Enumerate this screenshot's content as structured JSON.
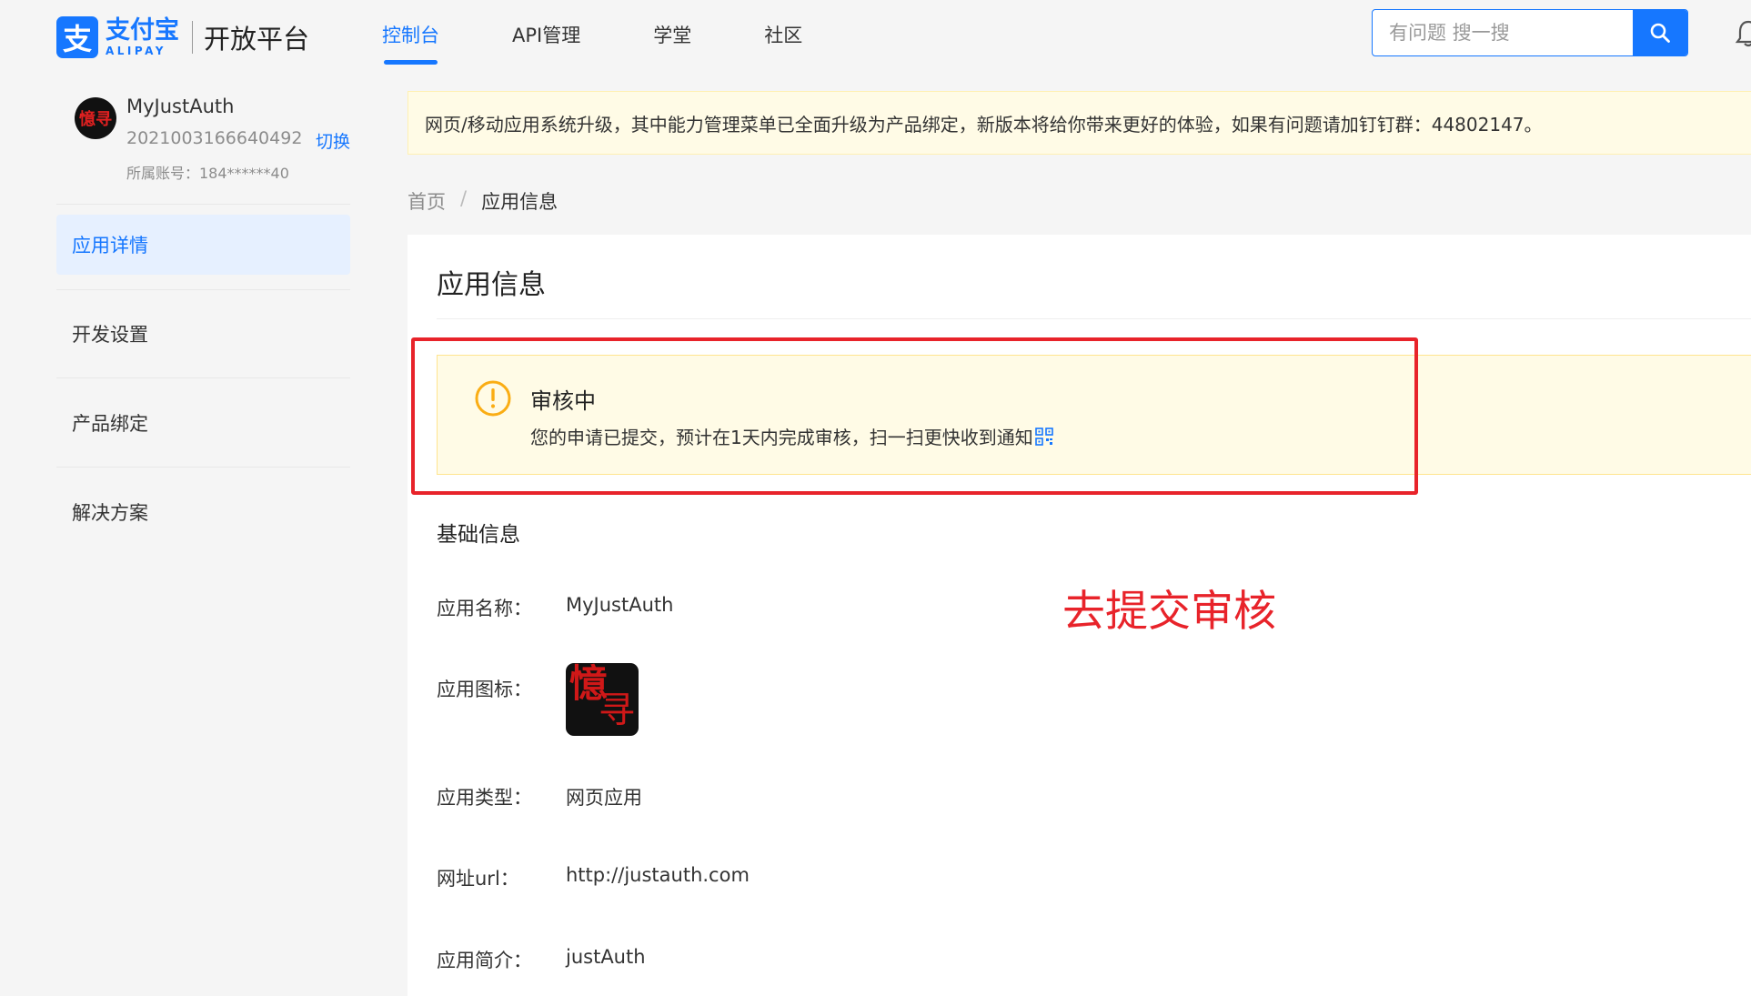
{
  "header": {
    "logo_mark": "支",
    "logo_cn": "支付宝",
    "logo_en": "ALIPAY",
    "platform": "开放平台",
    "nav": [
      {
        "label": "控制台",
        "active": true
      },
      {
        "label": "API管理",
        "active": false
      },
      {
        "label": "学堂",
        "active": false
      },
      {
        "label": "社区",
        "active": false
      }
    ],
    "search_placeholder": "有问题 搜一搜"
  },
  "sidebar": {
    "avatar_text": "憶寻",
    "account_name": "MyJustAuth",
    "account_id": "2021003166640492",
    "switch_label": "切换",
    "owner_text": "所属账号：184******40",
    "items": [
      {
        "label": "应用详情",
        "active": true
      },
      {
        "label": "开发设置",
        "active": false
      },
      {
        "label": "产品绑定",
        "active": false
      },
      {
        "label": "解决方案",
        "active": false
      }
    ]
  },
  "notice": "网页/移动应用系统升级，其中能力管理菜单已全面升级为产品绑定，新版本将给你带来更好的体验，如果有问题请加钉钉群：44802147。",
  "breadcrumb": {
    "home": "首页",
    "separator": "/",
    "current": "应用信息"
  },
  "card": {
    "title": "应用信息",
    "alert": {
      "title": "审核中",
      "desc": "您的申请已提交，预计在1天内完成审核，扫一扫更快收到通知",
      "color": "#faad14"
    },
    "annotation": "去提交审核",
    "section_title": "基础信息",
    "fields": {
      "name": {
        "label": "应用名称：",
        "value": "MyJustAuth"
      },
      "icon": {
        "label": "应用图标：",
        "char1": "憶",
        "char2": "寻"
      },
      "type": {
        "label": "应用类型：",
        "value": "网页应用"
      },
      "url": {
        "label": "网址url：",
        "value": "http://justauth.com"
      },
      "intro": {
        "label": "应用简介：",
        "value": "justAuth"
      }
    }
  },
  "colors": {
    "brand": "#1677ff",
    "annotation_red": "#e8232a",
    "warning": "#faad14"
  }
}
